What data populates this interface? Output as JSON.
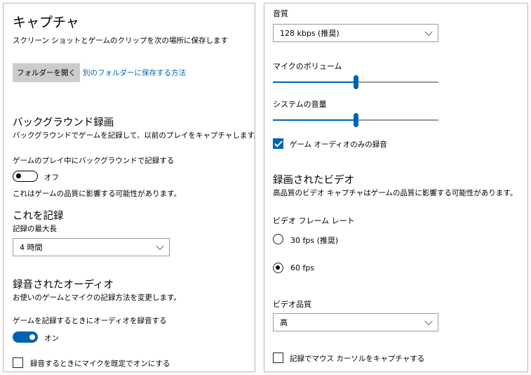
{
  "colors": {
    "accent": "#0063b1",
    "button_bg": "#cccccc",
    "border": "#b8b8b8"
  },
  "left": {
    "title": "キャプチャ",
    "location_desc": "スクリーン ショットとゲームのクリップを次の場所に保存します",
    "open_folder_label": "フォルダーを開く",
    "other_folder_link": "別のフォルダーに保存する方法",
    "background": {
      "heading": "バックグラウンド録画",
      "desc": "バックグラウンドでゲームを記録して、以前のプレイをキャプチャします。",
      "toggle_label": "ゲームのプレイ中にバックグラウンドで記録する",
      "toggle_state": "オフ",
      "note": "これはゲームの品質に影響する可能性があります。"
    },
    "record": {
      "heading": "これを記録",
      "max_label": "記録の最大長",
      "max_value": "4 時間"
    },
    "audio": {
      "heading": "録音されたオーディオ",
      "desc": "お使いのゲームとマイクの記録方法を変更します。",
      "toggle_label": "ゲームを記録するときにオーディオを録音する",
      "toggle_state": "オン",
      "mic_default_label": "録音するときにマイクを既定でオンにする"
    }
  },
  "right": {
    "quality_label": "音質",
    "quality_value": "128 kbps (推奨)",
    "mic_volume_label": "マイクのボリューム",
    "mic_volume_level": 0.5,
    "system_volume_label": "システムの音量",
    "system_volume_level": 0.5,
    "game_audio_only_label": "ゲーム オーディオのみの録音",
    "video": {
      "heading": "録画されたビデオ",
      "desc": "高品質のビデオ キャプチャはゲームの品質に影響する可能性があります。",
      "fps_label": "ビデオ フレーム レート",
      "fps_30": "30 fps (推奨)",
      "fps_60": "60 fps",
      "quality_label": "ビデオ品質",
      "quality_value": "高",
      "cursor_label": "記録でマウス カーソルをキャプチャする"
    }
  }
}
